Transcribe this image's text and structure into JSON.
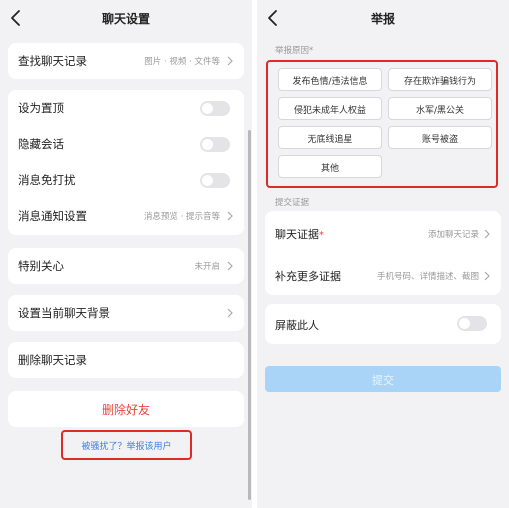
{
  "left": {
    "title": "聊天设置",
    "find_history": {
      "label": "查找聊天记录",
      "value": "图片 · 视频 · 文件等"
    },
    "pin": {
      "label": "设为置顶"
    },
    "hide_chat": {
      "label": "隐藏会话"
    },
    "mute": {
      "label": "消息免打扰"
    },
    "notify_settings": {
      "label": "消息通知设置",
      "value": "消息预览 · 提示音等"
    },
    "special_care": {
      "label": "特别关心",
      "value": "未开启"
    },
    "chat_background": {
      "label": "设置当前聊天背景"
    },
    "clear_history": {
      "label": "删除聊天记录"
    },
    "delete_friend": "删除好友",
    "report_link": "被骚扰了？举报该用户"
  },
  "right": {
    "title": "举报",
    "reasons_label": "举报原因*",
    "reasons": [
      "发布色情/违法信息",
      "存在欺诈骗钱行为",
      "侵犯未成年人权益",
      "水军/黑公关",
      "无底线追星",
      "账号被盗",
      "其他"
    ],
    "evidence_label": "提交证据",
    "chat_evidence": {
      "label": "聊天证据",
      "required_mark": "*",
      "value": "添加聊天记录"
    },
    "more_evidence": {
      "label": "补充更多证据",
      "value": "手机号码、详情描述、截图"
    },
    "block_user": {
      "label": "屏蔽此人"
    },
    "submit": "提交"
  },
  "colors": {
    "danger": "#e5463b",
    "link": "#3f7ee6",
    "highlight_border": "#e02a28",
    "submit_disabled": "#a9d3f7"
  },
  "icons": {
    "back": "chevron-left-icon",
    "disclosure": "chevron-right-icon"
  }
}
